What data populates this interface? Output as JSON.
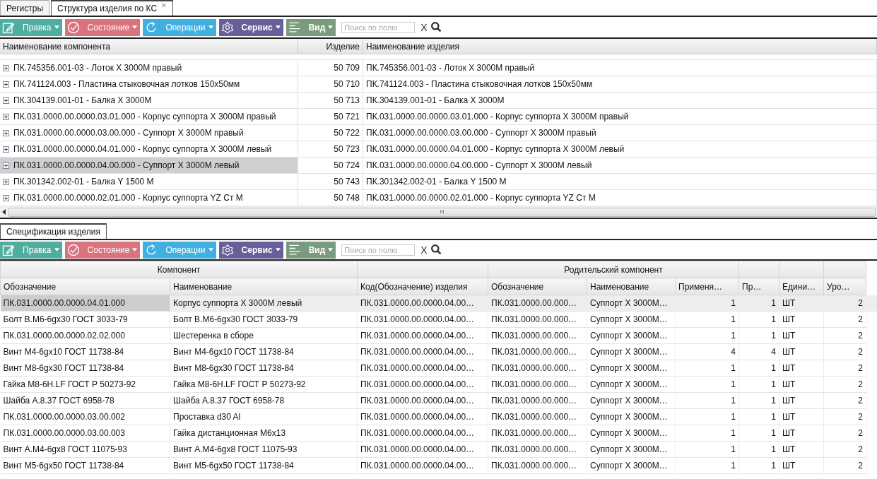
{
  "tabs": [
    {
      "label": "Регистры",
      "selected": false,
      "closable": false
    },
    {
      "label": "Структура изделия по КС",
      "selected": true,
      "closable": true
    }
  ],
  "close_glyph": "×",
  "top_toolbar": {
    "buttons": [
      {
        "label": "Правка",
        "color": "#4fae9f",
        "disabled": true
      },
      {
        "label": "Состояние",
        "color": "#d9737d",
        "disabled": true
      },
      {
        "label": "Операции",
        "color": "#3fb0e0",
        "disabled": true
      },
      {
        "label": "Сервис",
        "color": "#665f99",
        "disabled": false
      },
      {
        "label": "Вид",
        "color": "#7a9c7e",
        "disabled": false
      }
    ],
    "search": {
      "placeholder": "Поиск по полю"
    },
    "clear": "X"
  },
  "structure_table": {
    "columns": [
      "Наименование компонента",
      "Изделие",
      "Наименование изделия"
    ],
    "rows": [
      {
        "component": "ПК.745356.001-03 - Лоток X 3000M правый",
        "product": "50 709",
        "product_name": "ПК.745356.001-03 - Лоток X 3000M правый",
        "selected": false
      },
      {
        "component": "ПК.741124.003 - Пластина стыковочная лотков 150x50мм",
        "product": "50 710",
        "product_name": "ПК.741124.003 - Пластина стыковочная лотков 150x50мм",
        "selected": false
      },
      {
        "component": "ПК.304139.001-01 - Балка X 3000M",
        "product": "50 713",
        "product_name": "ПК.304139.001-01 - Балка X 3000M",
        "selected": false
      },
      {
        "component": "ПК.031.0000.00.0000.03.01.000 - Корпус суппорта X 3000M правый",
        "product": "50 721",
        "product_name": "ПК.031.0000.00.0000.03.01.000 - Корпус суппорта X 3000M правый",
        "selected": false
      },
      {
        "component": "ПК.031.0000.00.0000.03.00.000 - Суппорт X 3000M правый",
        "product": "50 722",
        "product_name": "ПК.031.0000.00.0000.03.00.000 - Суппорт X 3000M правый",
        "selected": false
      },
      {
        "component": "ПК.031.0000.00.0000.04.01.000 - Корпус суппорта X 3000M левый",
        "product": "50 723",
        "product_name": "ПК.031.0000.00.0000.04.01.000 - Корпус суппорта X 3000M левый",
        "selected": false
      },
      {
        "component": "ПК.031.0000.00.0000.04.00.000 - Суппорт X 3000M левый",
        "product": "50 724",
        "product_name": "ПК.031.0000.00.0000.04.00.000 - Суппорт X 3000M левый",
        "selected": true
      },
      {
        "component": "ПК.301342.002-01 - Балка Y 1500 M",
        "product": "50 743",
        "product_name": "ПК.301342.002-01 - Балка Y 1500 M",
        "selected": false
      },
      {
        "component": "ПК.031.0000.00.0000.02.01.000 - Корпус суппорта YZ Ст M",
        "product": "50 748",
        "product_name": "ПК.031.0000.00.0000.02.01.000 - Корпус суппорта YZ Ст M",
        "selected": false
      }
    ]
  },
  "scroll_grip": "III",
  "bottom_tab": {
    "label": "Спецификация изделия",
    "selected": true
  },
  "bottom_toolbar": {
    "buttons": [
      {
        "label": "Правка",
        "color": "#4fae9f",
        "disabled": true
      },
      {
        "label": "Состояние",
        "color": "#d9737d",
        "disabled": true
      },
      {
        "label": "Операции",
        "color": "#3fb0e0",
        "disabled": true
      },
      {
        "label": "Сервис",
        "color": "#665f99",
        "disabled": false
      },
      {
        "label": "Вид",
        "color": "#7a9c7e",
        "disabled": false
      }
    ],
    "search": {
      "placeholder": "Поиск по полю"
    },
    "clear": "X"
  },
  "spec_table": {
    "groups": [
      {
        "label": "Компонент"
      },
      {
        "label": "Родительский компонент"
      }
    ],
    "columns": [
      "Обозначение",
      "Наименование",
      "Код(Обозначение) изделия",
      "Обозначение",
      "Наименование",
      "Применя…",
      "Пр…",
      "Едини…",
      "Уро…"
    ],
    "rows": [
      {
        "cells": [
          "ПК.031.0000.00.0000.04.01.000",
          "Корпус суппорта X 3000M левый",
          "ПК.031.0000.00.0000.04.00…",
          "ПК.031.0000.00.000…",
          "Суппорт X 3000M…",
          "1",
          "1",
          "ШТ",
          "2"
        ],
        "selected": true
      },
      {
        "cells": [
          "Болт В.М6-6gx30 ГОСТ 3033-79",
          "Болт В.М6-6gx30 ГОСТ 3033-79",
          "ПК.031.0000.00.0000.04.00…",
          "ПК.031.0000.00.000…",
          "Суппорт X 3000M…",
          "1",
          "1",
          "ШТ",
          "2"
        ],
        "selected": false
      },
      {
        "cells": [
          "ПК.031.0000.00.0000.02.02.000",
          "Шестеренка в сборе",
          "ПК.031.0000.00.0000.04.00…",
          "ПК.031.0000.00.000…",
          "Суппорт X 3000M…",
          "1",
          "1",
          "ШТ",
          "2"
        ],
        "selected": false
      },
      {
        "cells": [
          "Винт М4-6gx10 ГОСТ 11738-84",
          "Винт М4-6gx10 ГОСТ 11738-84",
          "ПК.031.0000.00.0000.04.00…",
          "ПК.031.0000.00.000…",
          "Суппорт X 3000M…",
          "4",
          "4",
          "ШТ",
          "2"
        ],
        "selected": false
      },
      {
        "cells": [
          "Винт М8-6gx30 ГОСТ 11738-84",
          "Винт М8-6gx30 ГОСТ 11738-84",
          "ПК.031.0000.00.0000.04.00…",
          "ПК.031.0000.00.000…",
          "Суппорт X 3000M…",
          "1",
          "1",
          "ШТ",
          "2"
        ],
        "selected": false
      },
      {
        "cells": [
          "Гайка М8-6Н.LF ГОСТ Р 50273-92",
          "Гайка М8-6Н.LF ГОСТ Р 50273-92",
          "ПК.031.0000.00.0000.04.00…",
          "ПК.031.0000.00.000…",
          "Суппорт X 3000M…",
          "1",
          "1",
          "ШТ",
          "2"
        ],
        "selected": false
      },
      {
        "cells": [
          "Шайба А.8.37 ГОСТ 6958-78",
          "Шайба А.8.37 ГОСТ 6958-78",
          "ПК.031.0000.00.0000.04.00…",
          "ПК.031.0000.00.000…",
          "Суппорт X 3000M…",
          "1",
          "1",
          "ШТ",
          "2"
        ],
        "selected": false
      },
      {
        "cells": [
          "ПК.031.0000.00.0000.03.00.002",
          "Проставка d30 Al",
          "ПК.031.0000.00.0000.04.00…",
          "ПК.031.0000.00.000…",
          "Суппорт X 3000M…",
          "1",
          "1",
          "ШТ",
          "2"
        ],
        "selected": false
      },
      {
        "cells": [
          "ПК.031.0000.00.0000.03.00.003",
          "Гайка дистанционная М6x13",
          "ПК.031.0000.00.0000.04.00…",
          "ПК.031.0000.00.000…",
          "Суппорт X 3000M…",
          "1",
          "1",
          "ШТ",
          "2"
        ],
        "selected": false
      },
      {
        "cells": [
          "Винт А.М4-6gx8 ГОСТ 11075-93",
          "Винт А.М4-6gx8 ГОСТ 11075-93",
          "ПК.031.0000.00.0000.04.00…",
          "ПК.031.0000.00.000…",
          "Суппорт X 3000M…",
          "1",
          "1",
          "ШТ",
          "2"
        ],
        "selected": false
      },
      {
        "cells": [
          "Винт М5-6gx50 ГОСТ 11738-84",
          "Винт М5-6gx50 ГОСТ 11738-84",
          "ПК.031.0000.00.0000.04.00…",
          "ПК.031.0000.00.000…",
          "Суппорт X 3000M…",
          "1",
          "1",
          "ШТ",
          "2"
        ],
        "selected": false
      }
    ]
  }
}
